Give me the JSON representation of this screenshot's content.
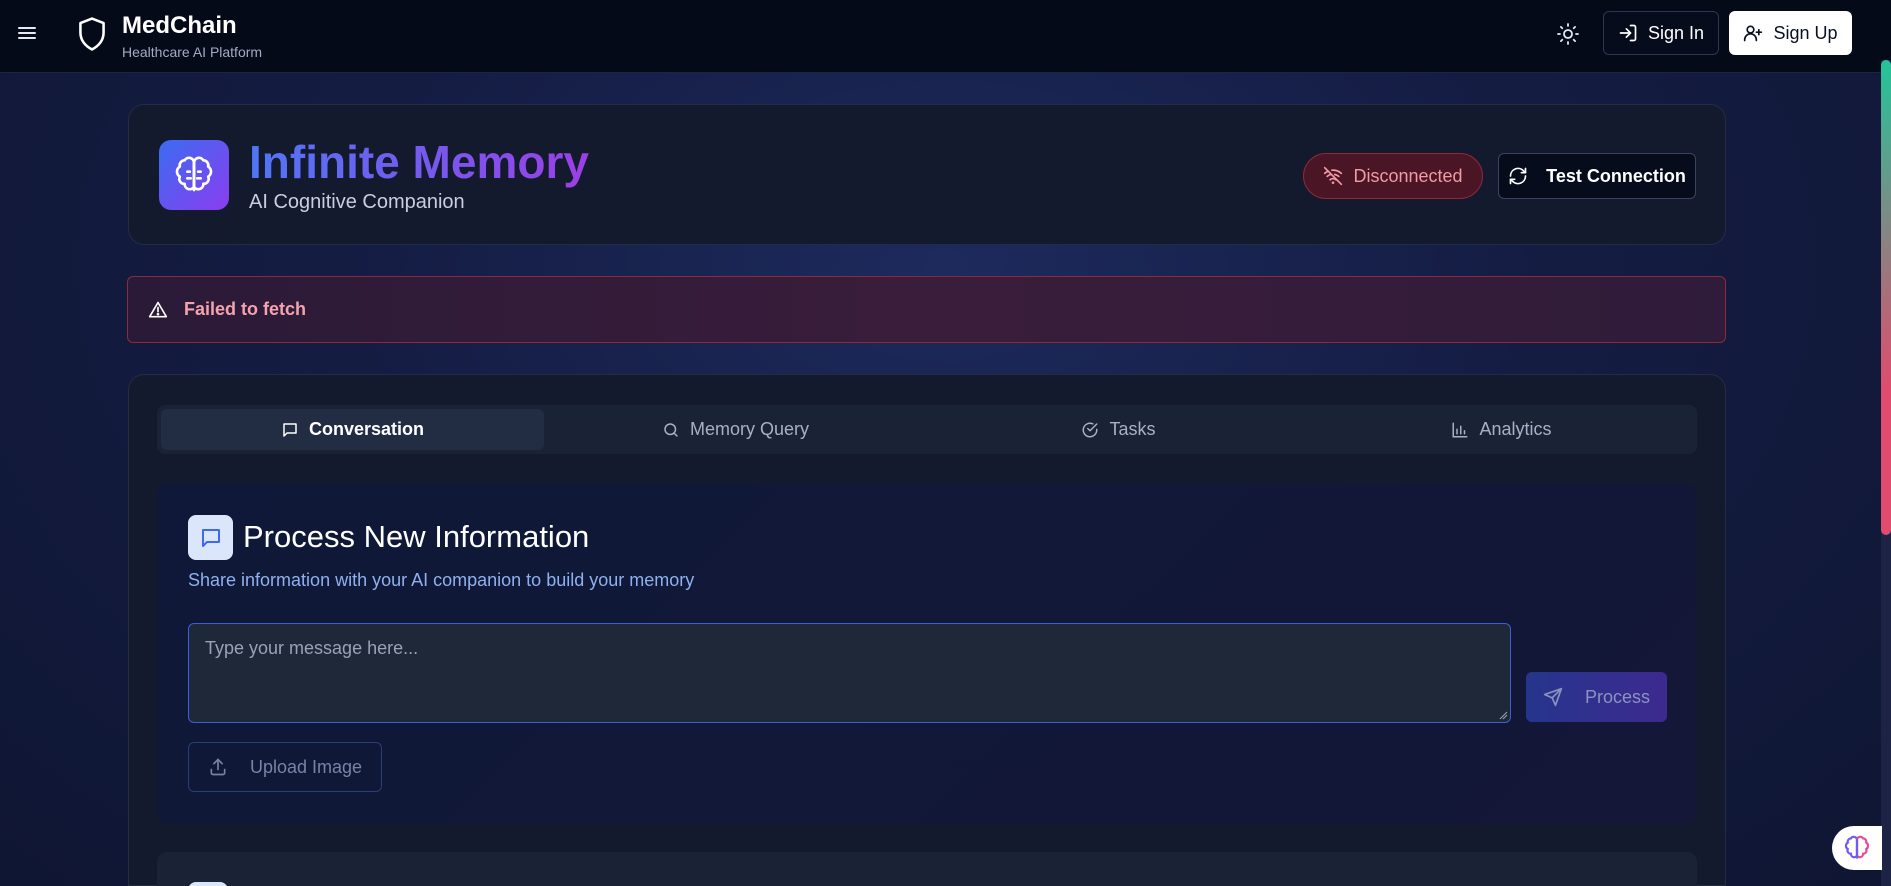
{
  "navbar": {
    "brand_name": "MedChain",
    "brand_subtitle": "Healthcare AI Platform",
    "signin_label": "Sign In",
    "signup_label": "Sign Up"
  },
  "header": {
    "title": "Infinite Memory",
    "subtitle": "AI Cognitive Companion",
    "status": "Disconnected",
    "test_connection_label": "Test Connection"
  },
  "error": {
    "message": "Failed to fetch"
  },
  "tabs": [
    {
      "label": "Conversation",
      "icon": "chat-icon",
      "active": true
    },
    {
      "label": "Memory Query",
      "icon": "search-icon",
      "active": false
    },
    {
      "label": "Tasks",
      "icon": "check-circle-icon",
      "active": false
    },
    {
      "label": "Analytics",
      "icon": "bar-chart-icon",
      "active": false
    }
  ],
  "process": {
    "title": "Process New Information",
    "description": "Share information with your AI companion to build your memory",
    "input_placeholder": "Type your message here...",
    "input_value": "",
    "process_label": "Process",
    "upload_label": "Upload Image"
  },
  "colors": {
    "accent_start": "#3b6cf0",
    "accent_end": "#8a3df0",
    "error": "#f4a3ad",
    "status_disconnected": "#f29aa6"
  }
}
